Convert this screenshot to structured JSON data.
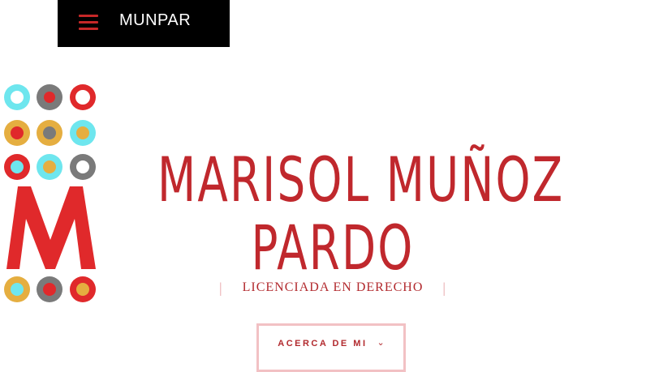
{
  "header": {
    "brand": "MUNPAR",
    "menu_icon": "hamburger-menu-icon"
  },
  "logo": {
    "letter": "M",
    "colors": {
      "red": "#e0292b",
      "gray": "#7a7a7a",
      "cyan": "#6ee6ee",
      "gold": "#e5ae40"
    }
  },
  "hero": {
    "title_line1": "MARISOL MUÑOZ",
    "title_line2": "PARDO",
    "subtitle": "LICENCIADA EN DERECHO",
    "cta_label": "ACERCA DE MI",
    "cta_icon": "chevron-down-icon",
    "accent_color": "#c0282d"
  }
}
